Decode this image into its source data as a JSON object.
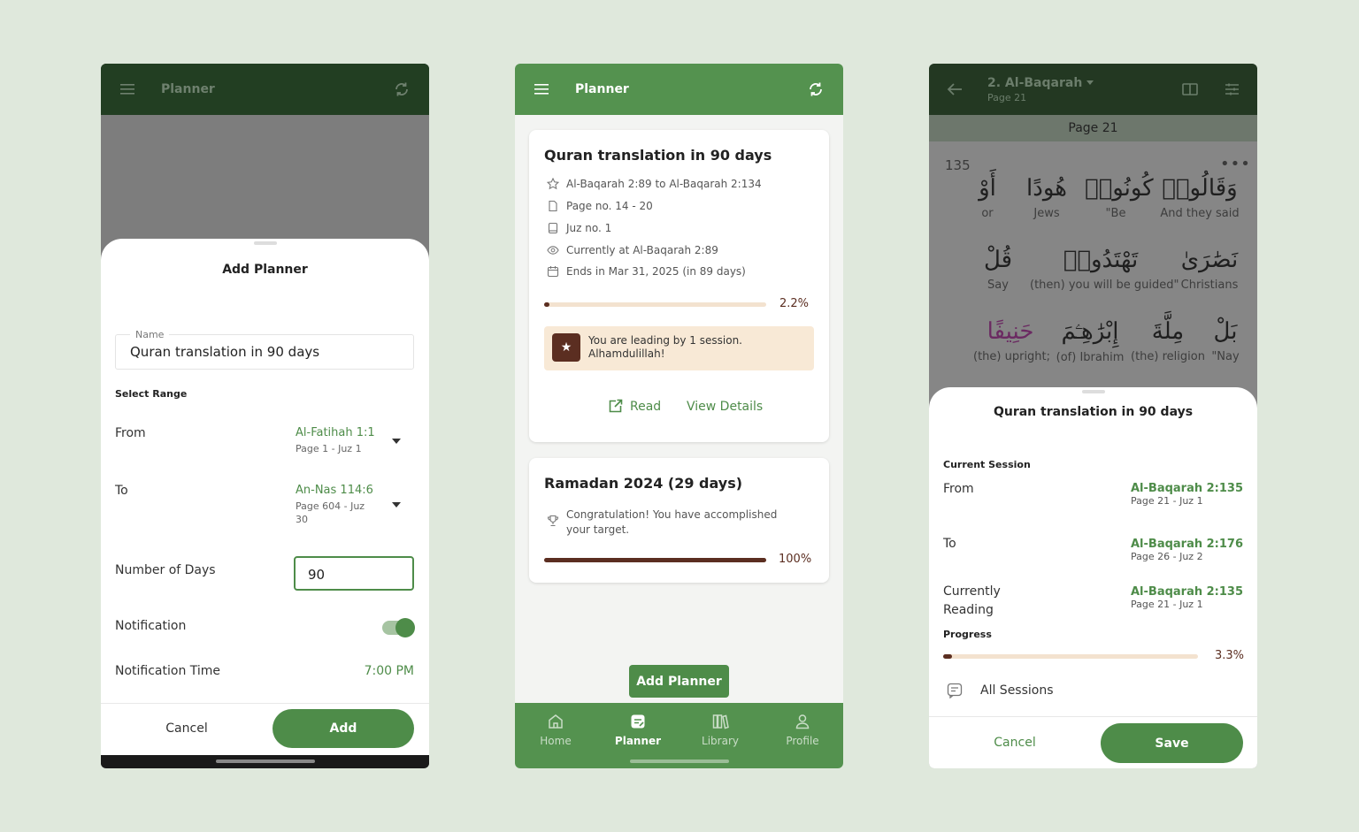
{
  "screen1": {
    "appbar_title": "Planner",
    "sheet_title": "Add Planner",
    "name_label": "Name",
    "name_value": "Quran translation in 90 days",
    "select_range_label": "Select Range",
    "from_label": "From",
    "from_value": "Al-Fatihah 1:1",
    "from_sub": "Page 1 - Juz 1",
    "to_label": "To",
    "to_value": "An-Nas 114:6",
    "to_sub": "Page 604 - Juz 30",
    "days_label": "Number of Days",
    "days_value": "90",
    "notification_label": "Notification",
    "notification_on": true,
    "notification_time_label": "Notification Time",
    "notification_time_value": "7:00 PM",
    "cancel_label": "Cancel",
    "add_label": "Add"
  },
  "screen2": {
    "appbar_title": "Planner",
    "card1": {
      "title": "Quran translation in 90 days",
      "rows": [
        {
          "icon": "star-icon",
          "text": "Al-Baqarah 2:89 to Al-Baqarah 2:134"
        },
        {
          "icon": "page-icon",
          "text": "Page no. 14 - 20"
        },
        {
          "icon": "book-icon",
          "text": "Juz no. 1"
        },
        {
          "icon": "eye-icon",
          "text": "Currently at Al-Baqarah 2:89"
        },
        {
          "icon": "calendar-icon",
          "text": "Ends in Mar 31, 2025 (in 89 days)"
        }
      ],
      "progress": 0.022,
      "progress_label": "2.2%",
      "banner_text": "You are leading by 1 session. Alhamdulillah!",
      "read_label": "Read",
      "details_label": "View Details"
    },
    "card2": {
      "title": "Ramadan 2024 (29 days)",
      "message": "Congratulation! You have accomplished your target.",
      "progress": 1.0,
      "progress_label": "100%"
    },
    "add_planner_label": "Add Planner",
    "tabs": [
      {
        "label": "Home",
        "icon": "home-icon",
        "active": false
      },
      {
        "label": "Planner",
        "icon": "planner-icon",
        "active": true
      },
      {
        "label": "Library",
        "icon": "library-icon",
        "active": false
      },
      {
        "label": "Profile",
        "icon": "profile-icon",
        "active": false
      }
    ]
  },
  "screen3": {
    "surah_title": "2. Al-Baqarah",
    "surah_page": "Page 21",
    "page_header": "Page 21",
    "ayah_number": "135",
    "words_row1": [
      {
        "ar": "أَوْ",
        "en": "or"
      },
      {
        "ar": "هُودًا",
        "en": "Jews"
      },
      {
        "ar": "كُونُوا۟",
        "en": "\"Be"
      },
      {
        "ar": "وَقَالُوا۟",
        "en": "And they said"
      }
    ],
    "words_row2": [
      {
        "ar": "قُلْ",
        "en": "Say"
      },
      {
        "ar": "تَهْتَدُوا۟",
        "en": "(then) you will be guided\""
      },
      {
        "ar": "نَصَٰرَىٰ",
        "en": "Christians"
      }
    ],
    "words_row3": [
      {
        "ar": "حَنِيفًا",
        "en": "(the) upright;"
      },
      {
        "ar": "إِبْرَٰهِـۧمَ",
        "en": "(of) Ibrahim"
      },
      {
        "ar": "مِلَّةَ",
        "en": "(the) religion"
      },
      {
        "ar": "بَلْ",
        "en": "\"Nay"
      }
    ],
    "sheet_title": "Quran translation in 90 days",
    "current_session_label": "Current Session",
    "from_label": "From",
    "from_value": "Al-Baqarah 2:135",
    "from_sub": "Page 21 - Juz 1",
    "to_label": "To",
    "to_value": "Al-Baqarah 2:176",
    "to_sub": "Page 26 - Juz 2",
    "current_label": "Currently Reading",
    "current_value": "Al-Baqarah 2:135",
    "current_sub": "Page 21 - Juz 1",
    "progress_label": "Progress",
    "progress": 0.033,
    "progress_pct": "3.3%",
    "all_sessions_label": "All Sessions",
    "cancel_label": "Cancel",
    "save_label": "Save"
  }
}
